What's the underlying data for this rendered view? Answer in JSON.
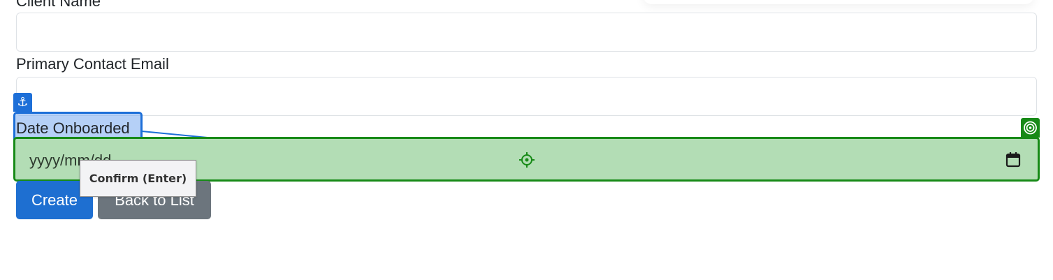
{
  "form": {
    "client_name_label": "Client Name",
    "client_name_value": "",
    "email_label": "Primary Contact Email",
    "email_value": "",
    "date_label": "Date Onboarded",
    "date_placeholder": "yyyy/mm/dd",
    "create_label": "Create",
    "back_label": "Back to List"
  },
  "overlay": {
    "anchor_icon": "anchor-icon",
    "target_icon": "target-icon",
    "crosshair_icon": "crosshair-icon",
    "tooltip": "Confirm (Enter)",
    "anchor_color": "#1d6fd8",
    "target_color": "#178a17"
  }
}
